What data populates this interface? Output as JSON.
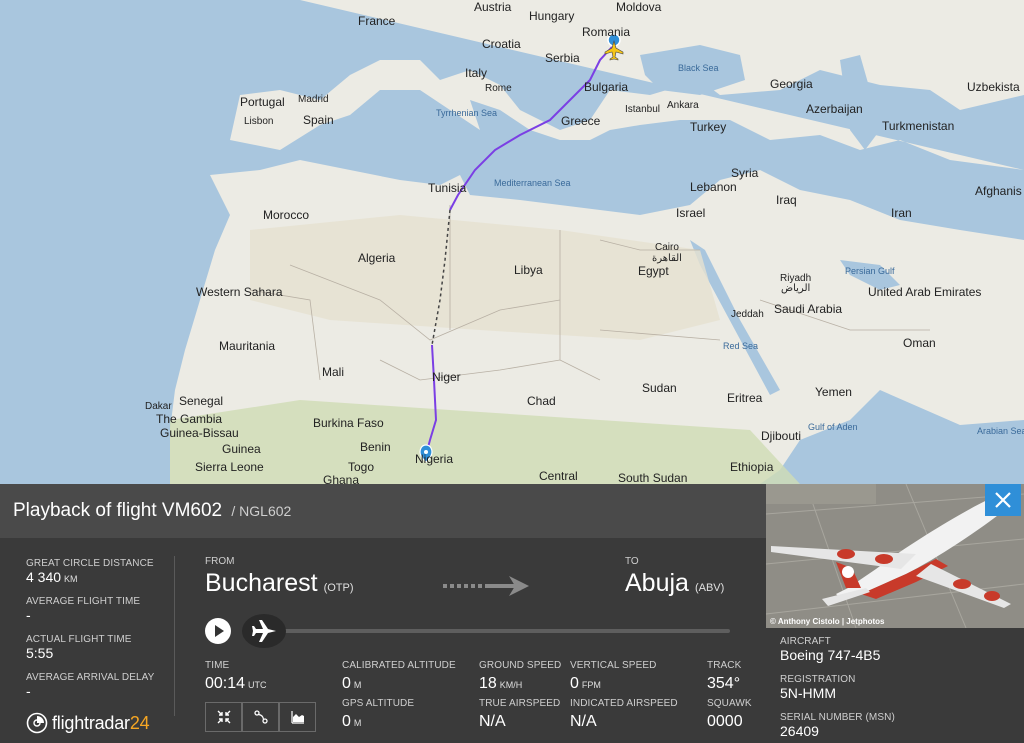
{
  "map": {
    "countries": [
      "France",
      "Austria",
      "Hungary",
      "Moldova",
      "Romania",
      "Croatia",
      "Serbia",
      "Italy",
      "Bulgaria",
      "Portugal",
      "Spain",
      "Greece",
      "Turkey",
      "Georgia",
      "Azerbaijan",
      "Uzbekista",
      "Turkmenistan",
      "Tunisia",
      "Syria",
      "Lebanon",
      "Iraq",
      "Israel",
      "Iran",
      "Afghanis",
      "Morocco",
      "Algeria",
      "Libya",
      "Egypt",
      "Western Sahara",
      "Mauritania",
      "Mali",
      "Niger",
      "Chad",
      "Sudan",
      "Saudi Arabia",
      "United Arab Emirates",
      "Oman",
      "Yemen",
      "Eritrea",
      "Djibouti",
      "Ethiopia",
      "South Sudan",
      "Central",
      "Senegal",
      "The Gambia",
      "Guinea-Bissau",
      "Guinea",
      "Sierra Leone",
      "Burkina Faso",
      "Benin",
      "Togo",
      "Ghana",
      "Nigeria"
    ],
    "cities": [
      "Madrid",
      "Lisbon",
      "Rome",
      "Istanbul",
      "Ankara",
      "Cairo",
      "القاهرة",
      "Riyadh",
      "الرياض",
      "Jeddah",
      "Dakar"
    ],
    "seas": [
      "Black Sea",
      "Tyrrhenian Sea",
      "Mediterranean Sea",
      "Persian Gulf",
      "Red Sea",
      "Gulf of Aden",
      "Arabian Sea"
    ]
  },
  "flight": {
    "title_prefix": "Playback of flight",
    "flight_number": "VM602",
    "callsign": "/ NGL602"
  },
  "stats": {
    "gc_distance_label": "GREAT CIRCLE DISTANCE",
    "gc_distance_value": "4 340",
    "gc_distance_unit": "KM",
    "avg_time_label": "AVERAGE FLIGHT TIME",
    "avg_time_value": "-",
    "actual_time_label": "ACTUAL FLIGHT TIME",
    "actual_time_value": "5:55",
    "avg_delay_label": "AVERAGE ARRIVAL DELAY",
    "avg_delay_value": "-"
  },
  "route": {
    "from_label": "FROM",
    "from_city": "Bucharest",
    "from_code": "(OTP)",
    "to_label": "TO",
    "to_city": "Abuja",
    "to_code": "(ABV)"
  },
  "playback": {
    "time_label": "TIME",
    "time_value": "00:14",
    "time_unit": "UTC",
    "progress": 0.0
  },
  "telemetry": {
    "cal_alt_label": "CALIBRATED ALTITUDE",
    "cal_alt_value": "0",
    "cal_alt_unit": "M",
    "gps_alt_label": "GPS ALTITUDE",
    "gps_alt_value": "0",
    "gps_alt_unit": "M",
    "ground_speed_label": "GROUND SPEED",
    "ground_speed_value": "18",
    "ground_speed_unit": "KM/H",
    "true_airspeed_label": "TRUE AIRSPEED",
    "true_airspeed_value": "N/A",
    "vertical_speed_label": "VERTICAL SPEED",
    "vertical_speed_value": "0",
    "vertical_speed_unit": "FPM",
    "ind_airspeed_label": "INDICATED AIRSPEED",
    "ind_airspeed_value": "N/A",
    "track_label": "TRACK",
    "track_value": "354°",
    "squawk_label": "SQUAWK",
    "squawk_value": "0000"
  },
  "logo": {
    "text": "flightradar",
    "num": "24"
  },
  "aircraft": {
    "photo_credit": "© Anthony Cistolo | Jetphotos",
    "aircraft_label": "AIRCRAFT",
    "aircraft_value": "Boeing 747-4B5",
    "registration_label": "REGISTRATION",
    "registration_value": "5N-HMM",
    "serial_label": "SERIAL NUMBER (MSN)",
    "serial_value": "26409"
  },
  "colors": {
    "route": "#7b3fe4",
    "accent": "#2f8fd8",
    "brand_orange": "#f5a623"
  }
}
